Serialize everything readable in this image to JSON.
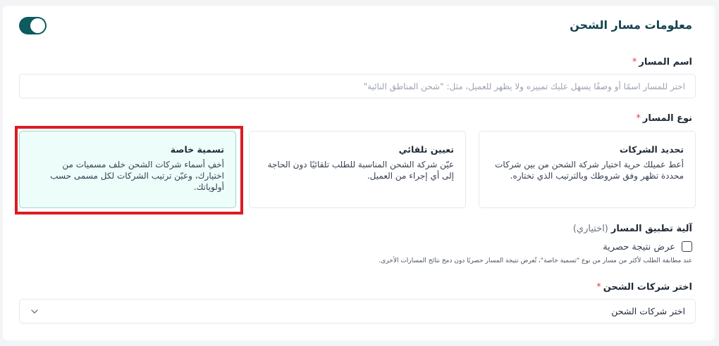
{
  "header": {
    "title": "معلومات مسار الشحن",
    "toggle_on": true
  },
  "route_name": {
    "label": "اسم المسار",
    "required_mark": "*",
    "placeholder": "اختر للمسار اسمًا أو وصفًا يسهل عليك تمييزه ولا يظهر للعميل، مثل: \"شحن المناطق النائية\""
  },
  "route_type": {
    "label": "نوع المسار",
    "required_mark": "*",
    "options": [
      {
        "title": "تحديد الشركات",
        "description": "أعط عميلك حرية اختيار شركة الشحن من بين شركات محددة تظهر وفق شروطك وبالترتيب الذي تختاره.",
        "selected": false
      },
      {
        "title": "تعيين تلقائي",
        "description": "عيّن شركة الشحن المناسبة للطلب تلقائيًا دون الحاجة إلى أي إجراء من العميل.",
        "selected": false
      },
      {
        "title": "تسمية خاصة",
        "description": "أخفِ أسماء شركات الشحن خلف مسميات من اختيارك، وعيّن ترتيب الشركات لكل مسمى حسب أولوياتك.",
        "selected": true
      }
    ]
  },
  "application": {
    "label": "آلية تطبيق المسار",
    "optional_note": "(اختياري)",
    "checkbox_label": "عرض نتيجة حصرية",
    "checked": false,
    "hint": "عند مطابقة الطلب لأكثر من مسار من نوع \"تسمية خاصة\"، تُعرض نتيجة المسار حصريًا دون دمج نتائج المسارات الأخرى."
  },
  "companies": {
    "label": "اختر شركات الشحن",
    "required_mark": "*",
    "selected_value": "اختر شركات الشحن"
  },
  "colors": {
    "accent": "#0d5a5f",
    "selected_card_bg": "#edfdf9",
    "highlight_border": "#dc1b23",
    "required": "#e0404a"
  }
}
